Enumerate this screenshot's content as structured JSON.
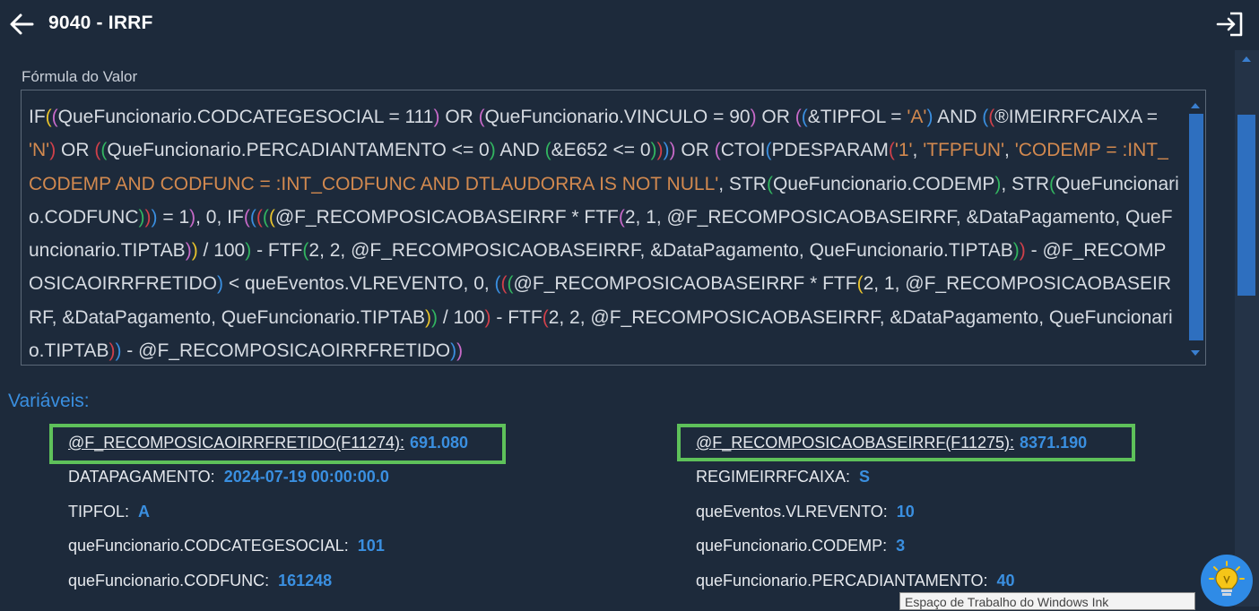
{
  "header": {
    "title": "9040 - IRRF",
    "back_icon": "arrow-left-icon",
    "exit_icon": "exit-icon"
  },
  "formula": {
    "label": "Fórmula do Valor",
    "tokens": [
      [
        "IF",
        ""
      ],
      [
        "(",
        "p1"
      ],
      [
        "(",
        "p2"
      ],
      [
        "QueFuncionario.CODCATEGESOCIAL = 111",
        ""
      ],
      [
        ")",
        "p2"
      ],
      [
        " OR ",
        ""
      ],
      [
        "(",
        "p2"
      ],
      [
        "QueFuncionario.VINCULO = 90",
        ""
      ],
      [
        ")",
        "p2"
      ],
      [
        " OR ",
        ""
      ],
      [
        "(",
        "p2"
      ],
      [
        "(",
        "p3"
      ],
      [
        "&TIPFOL = ",
        ""
      ],
      [
        "'A'",
        "str"
      ],
      [
        ")",
        "p3"
      ],
      [
        " AND ",
        ""
      ],
      [
        "(",
        "p3"
      ],
      [
        "(",
        "p4"
      ],
      [
        "®IMEIRRFCAIXA = ",
        ""
      ],
      [
        "'N'",
        "str"
      ],
      [
        ")",
        "p4"
      ],
      [
        " OR ",
        ""
      ],
      [
        "(",
        "p4"
      ],
      [
        "(",
        "p5"
      ],
      [
        "QueFuncionario.PERCADIANTAMENTO <= 0",
        ""
      ],
      [
        ")",
        "p5"
      ],
      [
        " AND ",
        ""
      ],
      [
        "(",
        "p5"
      ],
      [
        "&E652 <= 0",
        ""
      ],
      [
        ")",
        "p5"
      ],
      [
        ")",
        "p4"
      ],
      [
        ")",
        "p3"
      ],
      [
        ")",
        "p2"
      ],
      [
        " OR ",
        ""
      ],
      [
        "(",
        "p2"
      ],
      [
        "CTOI",
        ""
      ],
      [
        "(",
        "p3"
      ],
      [
        "PDESPARAM",
        ""
      ],
      [
        "(",
        "p4"
      ],
      [
        "'1'",
        "str"
      ],
      [
        ", ",
        ""
      ],
      [
        "'TFPFUN'",
        "str"
      ],
      [
        ", ",
        ""
      ],
      [
        "'CODEMP = :INT_CODEMP AND CODFUNC = :INT_CODFUNC AND DTLAUDORRA IS NOT NULL'",
        "str"
      ],
      [
        ", STR",
        ""
      ],
      [
        "(",
        "p5"
      ],
      [
        "QueFuncionario.CODEMP",
        ""
      ],
      [
        ")",
        "p5"
      ],
      [
        ", STR",
        ""
      ],
      [
        "(",
        "p5"
      ],
      [
        "QueFuncionario.CODFUNC",
        ""
      ],
      [
        ")",
        "p5"
      ],
      [
        ")",
        "p4"
      ],
      [
        ")",
        "p3"
      ],
      [
        " = 1",
        ""
      ],
      [
        ")",
        "p2"
      ],
      [
        ", 0, IF",
        ""
      ],
      [
        "(",
        "p2"
      ],
      [
        "(",
        "p3"
      ],
      [
        "(",
        "p4"
      ],
      [
        "(",
        "p5"
      ],
      [
        "(",
        "p1"
      ],
      [
        "@F_RECOMPOSICAOBASEIRRF * FTF",
        ""
      ],
      [
        "(",
        "p2"
      ],
      [
        "2, 1, @F_RECOMPOSICAOBASEIRRF, &DataPagamento, QueFuncionario.TIPTAB",
        ""
      ],
      [
        ")",
        "p2"
      ],
      [
        ")",
        "p1"
      ],
      [
        " / 100",
        ""
      ],
      [
        ")",
        "p5"
      ],
      [
        " - FTF",
        ""
      ],
      [
        "(",
        "p5"
      ],
      [
        "2, 2, @F_RECOMPOSICAOBASEIRRF, &DataPagamento, QueFuncionario.TIPTAB",
        ""
      ],
      [
        ")",
        "p5"
      ],
      [
        ")",
        "p4"
      ],
      [
        " - @F_RECOMPOSICAOIRRFRETIDO",
        ""
      ],
      [
        ")",
        "p3"
      ],
      [
        " < queEventos.VLREVENTO, 0, ",
        ""
      ],
      [
        "(",
        "p3"
      ],
      [
        "(",
        "p4"
      ],
      [
        "(",
        "p5"
      ],
      [
        "@F_RECOMPOSICAOBASEIRRF * FTF",
        ""
      ],
      [
        "(",
        "p1"
      ],
      [
        "2, 1, @F_RECOMPOSICAOBASEIRRF, &DataPagamento, QueFuncionario.TIPTAB",
        ""
      ],
      [
        ")",
        "p1"
      ],
      [
        ")",
        "p5"
      ],
      [
        " / 100",
        ""
      ],
      [
        ")",
        "p4"
      ],
      [
        " - FTF",
        ""
      ],
      [
        "(",
        "p4"
      ],
      [
        "2, 2, @F_RECOMPOSICAOBASEIRRF, &DataPagamento, QueFuncionario.TIPTAB",
        ""
      ],
      [
        ")",
        "p4"
      ],
      [
        ")",
        "p3"
      ],
      [
        " - @F_RECOMPOSICAOIRRFRETIDO",
        ""
      ],
      [
        ")",
        "p3"
      ],
      [
        ")",
        "p2"
      ]
    ]
  },
  "variables": {
    "title": "Variáveis:",
    "left": [
      {
        "name": "@F_RECOMPOSICAOIRRFRETIDO(F11274):",
        "value": "691.080",
        "highlighted": true
      },
      {
        "name": "DATAPAGAMENTO:",
        "value": "2024-07-19 00:00:00.0"
      },
      {
        "name": "TIPFOL:",
        "value": "A"
      },
      {
        "name": "queFuncionario.CODCATEGESOCIAL:",
        "value": "101"
      },
      {
        "name": "queFuncionario.CODFUNC:",
        "value": "161248"
      }
    ],
    "right": [
      {
        "name": "@F_RECOMPOSICAOBASEIRRF(F11275):",
        "value": "8371.190",
        "highlighted": true
      },
      {
        "name": "REGIMEIRRFCAIXA:",
        "value": "S"
      },
      {
        "name": "queEventos.VLREVENTO:",
        "value": "10"
      },
      {
        "name": "queFuncionario.CODEMP:",
        "value": "3"
      },
      {
        "name": "queFuncionario.PERCADIANTAMENTO:",
        "value": "40"
      }
    ]
  },
  "colors": {
    "background": "#1d2a3b",
    "accent": "#3a8fe0",
    "highlight_border": "#5ec15a",
    "string_literal": "#d2894f"
  },
  "assistant": {
    "icon": "lightbulb-icon"
  },
  "tooltip": {
    "text": "Espaço de Trabalho do Windows Ink"
  }
}
